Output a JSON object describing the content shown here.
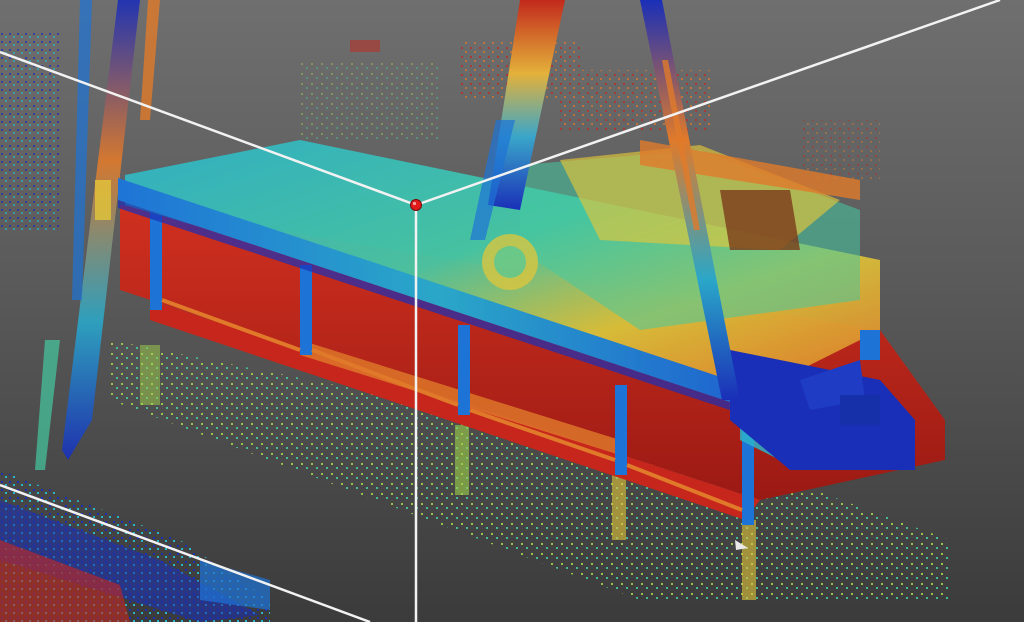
{
  "viewer": {
    "colormap": [
      "#1a2fb8",
      "#1e73d6",
      "#2bb3c9",
      "#46c9a0",
      "#9fd24a",
      "#e2c63a",
      "#e07a2a",
      "#c6261c"
    ],
    "background_top": "#6f6f6f",
    "background_bottom": "#3b3b3b",
    "pick_point_color": "#e01b1b",
    "crosshair_color": "#f2f2f2"
  },
  "icons": {
    "pick_point": "red-dot-icon",
    "axes": "crosshair-axes-icon"
  }
}
